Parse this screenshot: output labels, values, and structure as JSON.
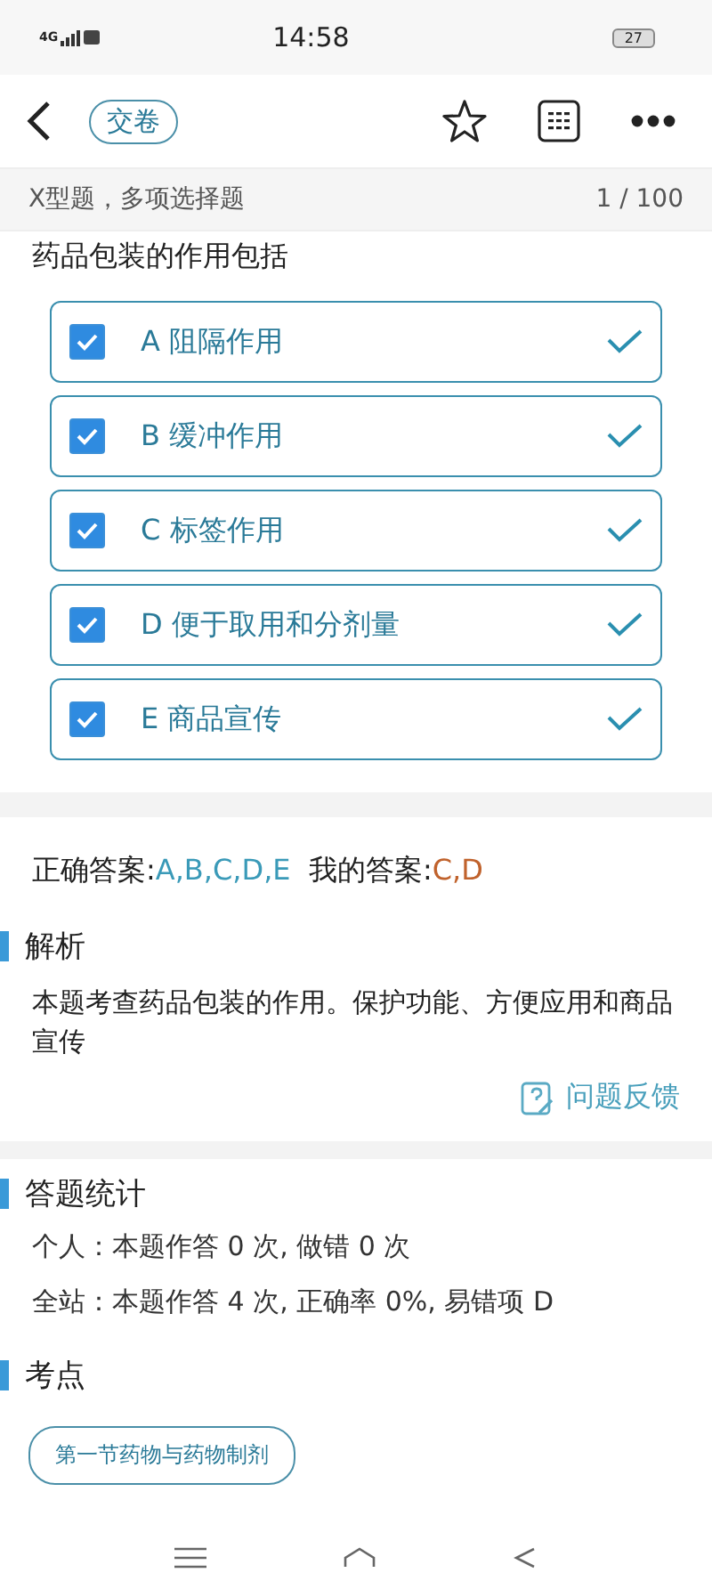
{
  "status_bar": {
    "network": "4G",
    "time": "14:58",
    "battery": "27"
  },
  "header": {
    "submit_button": "交卷"
  },
  "question_bar": {
    "type": "X型题，多项选择题",
    "progress": "1 / 100"
  },
  "question": "药品包装的作用包括",
  "options": [
    {
      "label": "A 阻隔作用",
      "checked": true,
      "correct": true
    },
    {
      "label": "B 缓冲作用",
      "checked": true,
      "correct": true
    },
    {
      "label": "C 标签作用",
      "checked": true,
      "correct": true
    },
    {
      "label": "D 便于取用和分剂量",
      "checked": true,
      "correct": true
    },
    {
      "label": "E 商品宣传",
      "checked": true,
      "correct": true
    }
  ],
  "answer": {
    "correct_label": "正确答案:",
    "correct_value": "A,B,C,D,E",
    "mine_label": "我的答案:",
    "mine_value": "C,D"
  },
  "analysis": {
    "heading": "解析",
    "text": "本题考查药品包装的作用。保护功能、方便应用和商品宣传",
    "feedback": "问题反馈"
  },
  "stats": {
    "heading": "答题统计",
    "lines": [
      "个人：本题作答 0 次, 做错 0 次",
      "全站：本题作答 4 次, 正确率 0%, 易错项 D"
    ]
  },
  "points": {
    "heading": "考点",
    "tags": [
      "第一节药物与药物制剂"
    ]
  }
}
